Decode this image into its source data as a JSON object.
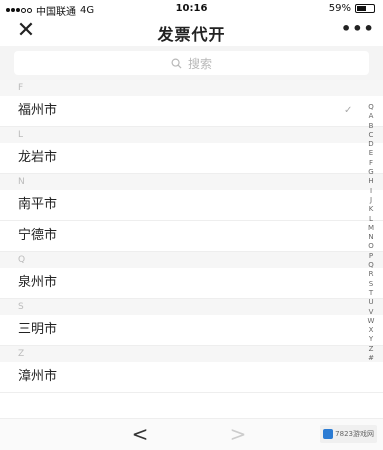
{
  "status_bar": {
    "carrier": "中国联通",
    "network": "4G",
    "time": "10:16",
    "battery": "59%",
    "battery_level": 0.59
  },
  "nav": {
    "close_icon": "close-icon",
    "title": "发票代开",
    "more_label": "•••"
  },
  "search": {
    "placeholder": "搜索",
    "icon": "search-icon"
  },
  "sections": [
    {
      "letter": "F",
      "cities": [
        "福州市"
      ]
    },
    {
      "letter": "L",
      "cities": [
        "龙岩市"
      ]
    },
    {
      "letter": "N",
      "cities": [
        "南平市",
        "宁德市"
      ]
    },
    {
      "letter": "Q",
      "cities": [
        "泉州市"
      ]
    },
    {
      "letter": "S",
      "cities": [
        "三明市"
      ]
    },
    {
      "letter": "Z",
      "cities": [
        "漳州市"
      ]
    }
  ],
  "index_letters": [
    "Q",
    "A",
    "B",
    "C",
    "D",
    "E",
    "F",
    "G",
    "H",
    "I",
    "J",
    "K",
    "L",
    "M",
    "N",
    "O",
    "P",
    "Q",
    "R",
    "S",
    "T",
    "U",
    "V",
    "W",
    "X",
    "Y",
    "Z",
    "#"
  ],
  "bottom_bar": {
    "back_label": "<",
    "forward_label": ">",
    "watermark": "7823游戏网"
  },
  "colors": {
    "accent": "#2b7bd3",
    "section_bg": "#f6f6f6",
    "divider": "#eeeeee"
  }
}
